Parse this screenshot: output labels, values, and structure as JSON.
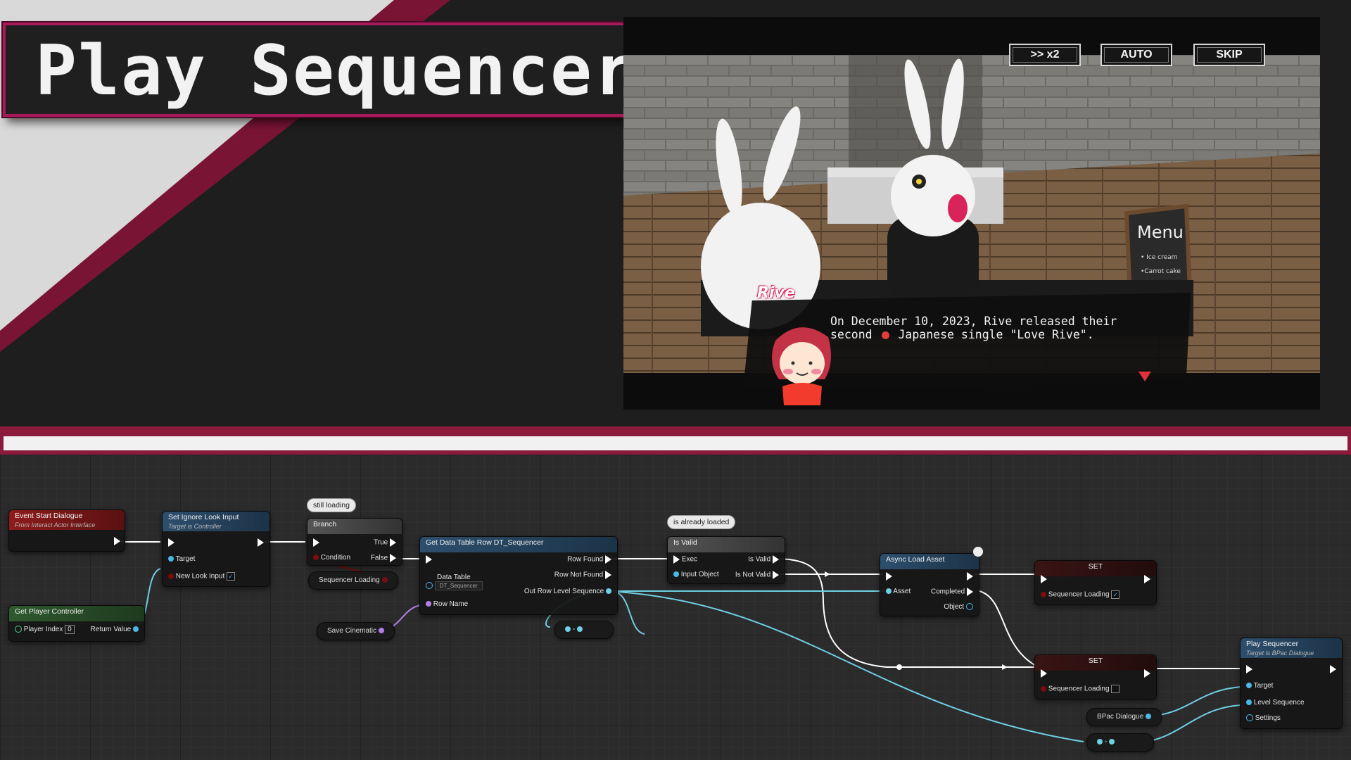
{
  "banner": {
    "title": "Play Sequencer"
  },
  "game": {
    "buttons": {
      "speed": ">> x2",
      "auto": "AUTO",
      "skip": "SKIP"
    },
    "dialogue": {
      "speaker": "Rive",
      "line1": "On December 10, 2023, Rive released their",
      "line2_a": "second",
      "line2_b": "Japanese single \"Love Rive\"."
    },
    "scene_text": {
      "menu_sign": "Menu",
      "menu_item1": "• Ice cream",
      "menu_item2": "•Carrot cake"
    }
  },
  "blueprint": {
    "comments": {
      "still_loading": "still loading",
      "already_loaded": "is already loaded"
    },
    "event_start_dialogue": {
      "title": "Event Start Dialogue",
      "subtitle": "From Interact Actor Interface"
    },
    "get_player_controller": {
      "title": "Get Player Controller",
      "player_index_label": "Player Index",
      "player_index_value": "0",
      "return_value": "Return Value"
    },
    "set_ignore_look_input": {
      "title": "Set Ignore Look Input",
      "subtitle": "Target is Controller",
      "target": "Target",
      "new_look_input": "New Look Input"
    },
    "branch": {
      "title": "Branch",
      "true": "True",
      "false": "False",
      "condition": "Condition"
    },
    "sequencer_loading_var": "Sequencer Loading",
    "save_cinematic_var": "Save Cinematic",
    "get_data_table_row": {
      "title": "Get Data Table Row DT_Sequencer",
      "data_table": "Data Table",
      "data_table_value": "DT_Sequencer",
      "row_name": "Row Name",
      "row_found": "Row Found",
      "row_not_found": "Row Not Found",
      "out_row": "Out Row Level Sequence"
    },
    "is_valid": {
      "title": "Is Valid",
      "exec": "Exec",
      "input_object": "Input Object",
      "is_valid": "Is Valid",
      "is_not_valid": "Is Not Valid"
    },
    "async_load_asset": {
      "title": "Async Load Asset",
      "asset": "Asset",
      "completed": "Completed",
      "object": "Object"
    },
    "set_true": {
      "title": "SET",
      "label": "Sequencer Loading"
    },
    "set_false": {
      "title": "SET",
      "label": "Sequencer Loading"
    },
    "bpac_dialogue_var": "BPac Dialogue",
    "play_sequencer": {
      "title": "Play Sequencer",
      "subtitle": "Target is BPac Dialogue",
      "target": "Target",
      "level_sequence": "Level Sequence",
      "settings": "Settings"
    }
  },
  "colors": {
    "accent": "#a8195a",
    "exec_wire": "#ffffff",
    "object_wire": "#7fd3e6",
    "bool_pin": "#8b0000",
    "function_header": "#2d4f6e",
    "event_header": "#8e1b1b",
    "pure_header": "#2f5a2f"
  }
}
